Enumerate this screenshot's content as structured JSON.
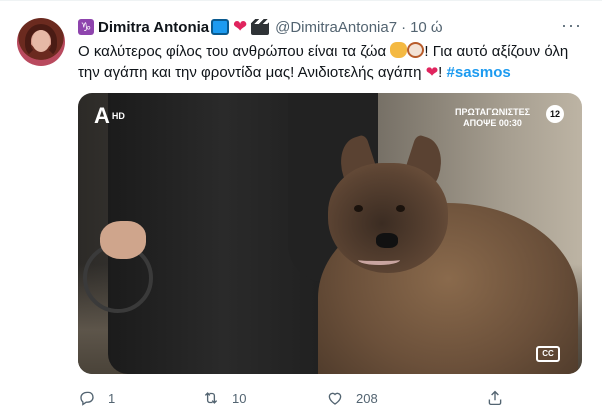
{
  "tweet": {
    "author": {
      "zodiac_symbol": "♑",
      "name": "Dimitra Antonia",
      "handle": "@DimitraAntonia7",
      "separator": "·",
      "time": "10 ώ"
    },
    "more_label": "···",
    "text_part1": "Ο καλύτερος φίλος του ανθρώπου είναι τα ζώα ",
    "text_part2": "! Για αυτό αξίζουν όλη την αγάπη και την φροντίδα μας! Ανιδιοτελής αγάπη ",
    "heart_glyph": "❤",
    "text_part3": "! ",
    "hashtag": "#sasmos",
    "media": {
      "channel_logo": "A",
      "channel_hd": "HD",
      "promo_line1": "ΠΡΩΤΑΓΩΝΙΣΤΕΣ",
      "promo_line2": "ΑΠΟΨΕ 00:30",
      "rating": "12",
      "cc_label": "CC"
    },
    "actions": {
      "reply_count": "1",
      "retweet_count": "10",
      "like_count": "208"
    }
  },
  "colors": {
    "accent": "#1d9bf0",
    "secondary_text": "#536471",
    "heart": "#e0245e"
  },
  "icons": {
    "reply": "reply-icon",
    "retweet": "retweet-icon",
    "like": "like-icon",
    "share": "share-icon"
  }
}
